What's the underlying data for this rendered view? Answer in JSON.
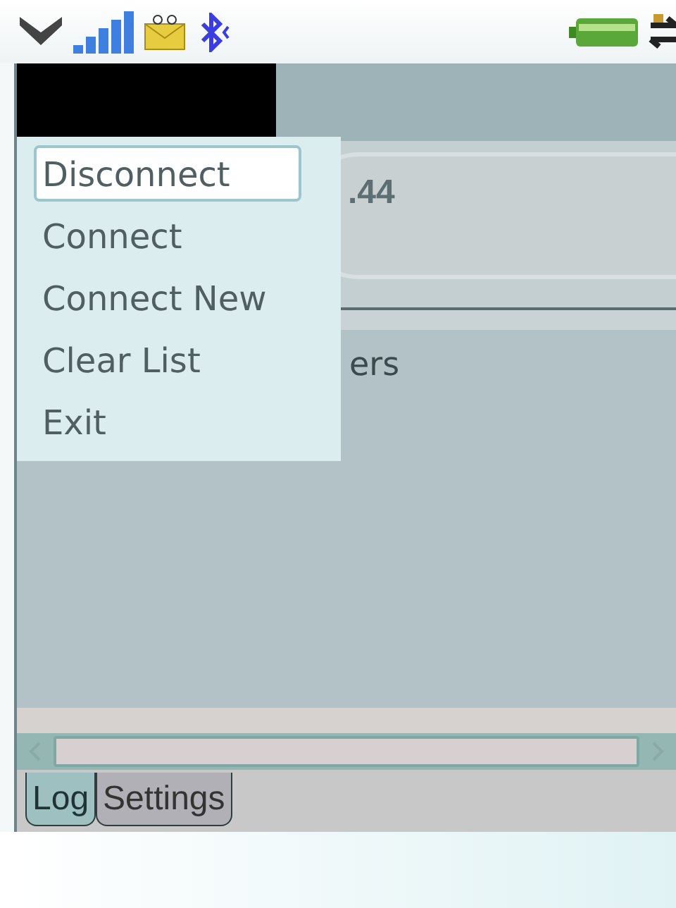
{
  "field": {
    "value": ".44"
  },
  "log": {
    "lines": [
      "ers"
    ]
  },
  "tabs": [
    {
      "label": "Log",
      "selected": true
    },
    {
      "label": "Settings",
      "selected": false
    }
  ],
  "menu": {
    "items": [
      {
        "label": "Disconnect",
        "selected": true
      },
      {
        "label": "Connect",
        "selected": false
      },
      {
        "label": "Connect New",
        "selected": false
      },
      {
        "label": "Clear List",
        "selected": false
      },
      {
        "label": "Exit",
        "selected": false
      }
    ]
  }
}
